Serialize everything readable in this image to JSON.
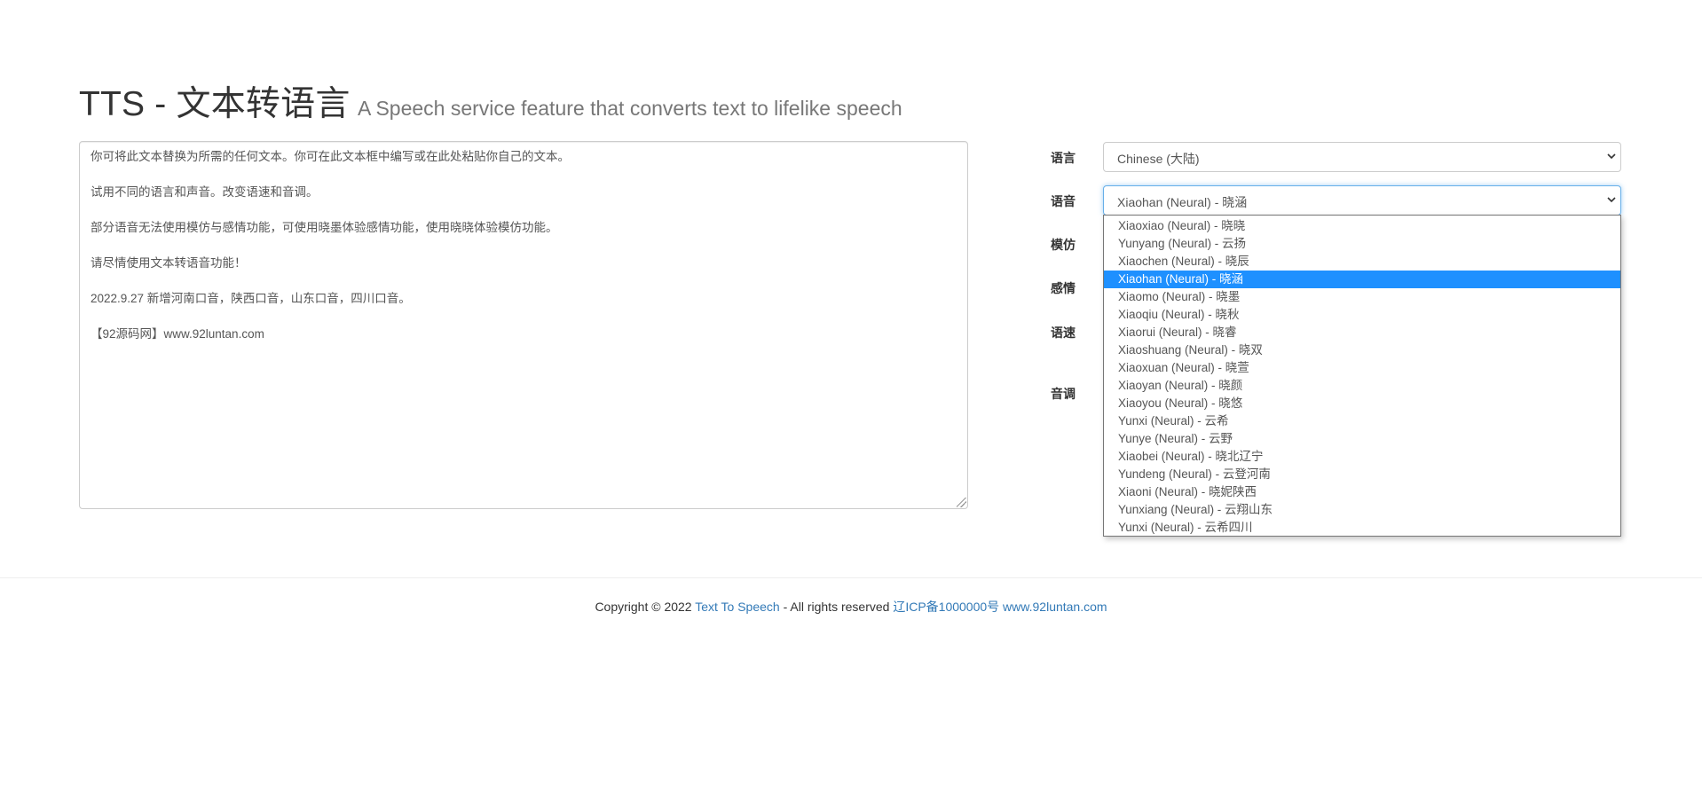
{
  "header": {
    "title": "TTS - 文本转语言",
    "subtitle": "A Speech service feature that converts text to lifelike speech"
  },
  "editor": {
    "lines": [
      "你可将此文本替换为所需的任何文本。你可在此文本框中编写或在此处粘贴你自己的文本。",
      "试用不同的语言和声音。改变语速和音调。",
      "部分语音无法使用模仿与感情功能，可使用晓墨体验感情功能，使用晓晓体验模仿功能。",
      "请尽情使用文本转语音功能！",
      "2022.9.27 新增河南口音，陕西口音，山东口音，四川口音。",
      "【92源码网】www.92luntan.com"
    ]
  },
  "form": {
    "language_label": "语言",
    "language_value": "Chinese (大陆)",
    "voice_label": "语音",
    "voice_value": "Xiaohan (Neural) - 晓涵",
    "imitate_label": "模仿",
    "emotion_label": "感情",
    "rate_label": "语速",
    "pitch_label": "音调"
  },
  "voice_options": [
    "Xiaoxiao (Neural) - 晓晓",
    "Yunyang (Neural) - 云扬",
    "Xiaochen (Neural) - 晓辰",
    "Xiaohan (Neural) - 晓涵",
    "Xiaomo (Neural) - 晓墨",
    "Xiaoqiu (Neural) - 晓秋",
    "Xiaorui (Neural) - 晓睿",
    "Xiaoshuang (Neural) - 晓双",
    "Xiaoxuan (Neural) - 晓萱",
    "Xiaoyan (Neural) - 晓颜",
    "Xiaoyou (Neural) - 晓悠",
    "Yunxi (Neural) - 云希",
    "Yunye (Neural) - 云野",
    "Xiaobei (Neural) - 晓北辽宁",
    "Yundeng (Neural) - 云登河南",
    "Xiaoni (Neural) - 晓妮陕西",
    "Yunxiang (Neural) - 云翔山东",
    "Yunxi (Neural) - 云希四川"
  ],
  "selected_voice_index": 3,
  "footer": {
    "copyright": "Copyright © 2022",
    "site_link": "Text To Speech",
    "rights": "- All rights reserved",
    "icp_link": "辽ICP备1000000号 www.92luntan.com"
  },
  "colors": {
    "selection": "#1e90ff",
    "link": "#337ab7",
    "focus": "#66afe9"
  }
}
